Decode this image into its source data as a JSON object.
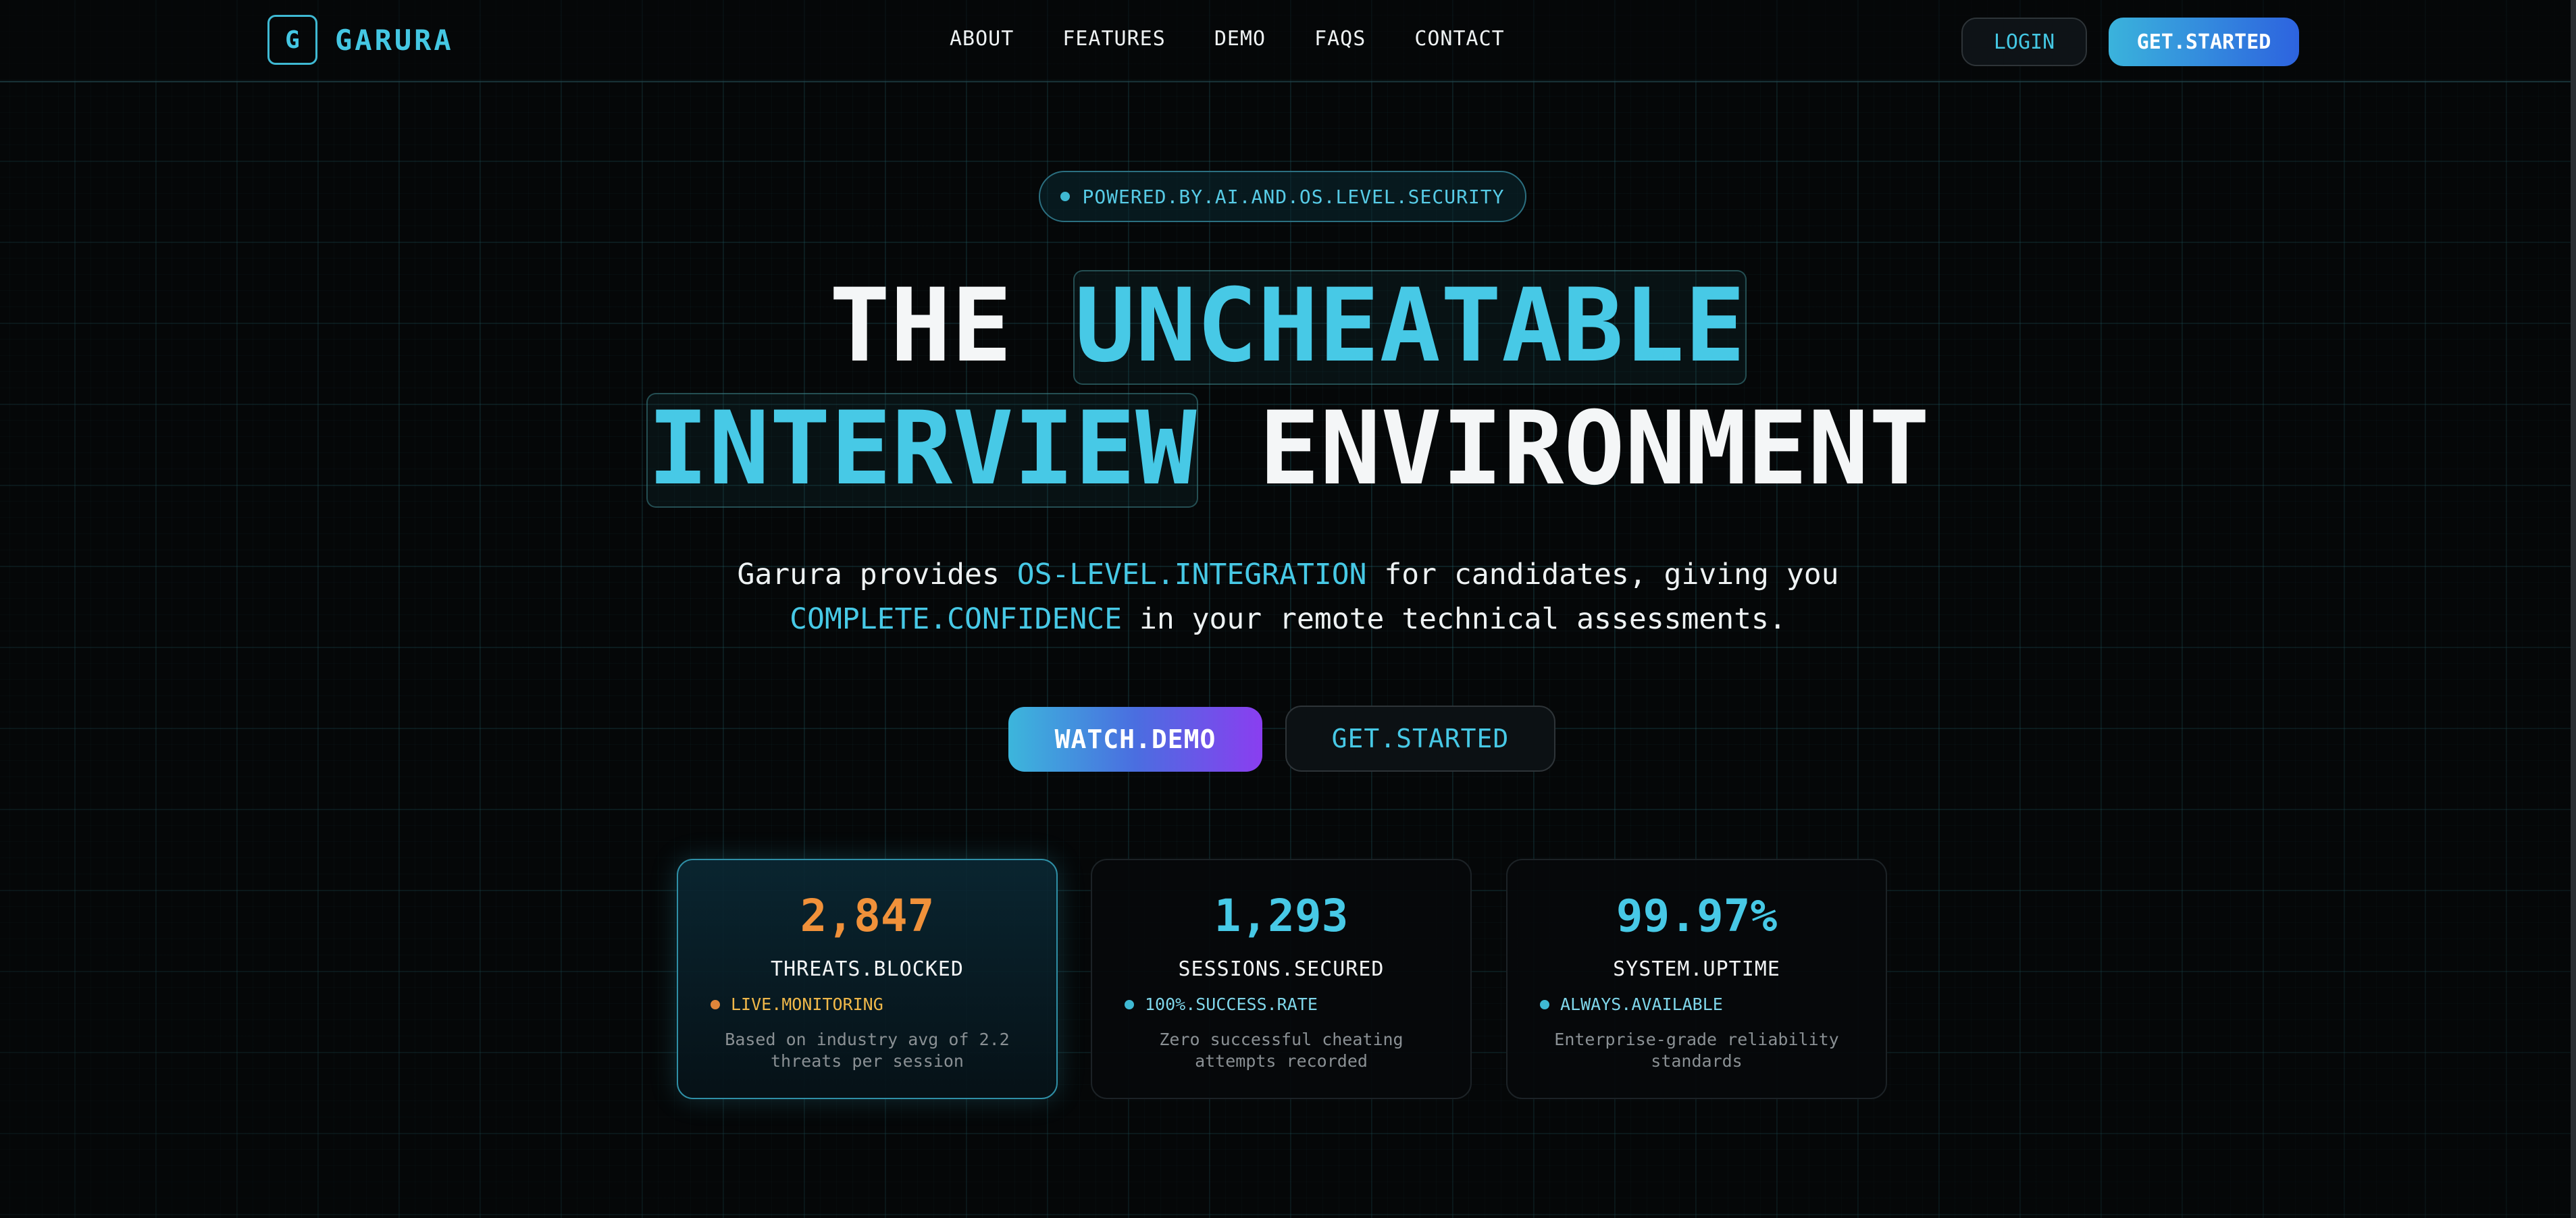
{
  "colors": {
    "accent_cyan": "#47c9e6",
    "accent_orange": "#f0913a",
    "gradient_purple": "#8a3ef0",
    "gradient_blue": "#2d63df",
    "background": "#050708"
  },
  "nav": {
    "logo_letter": "G",
    "brand": "GARURA",
    "links": [
      "ABOUT",
      "FEATURES",
      "DEMO",
      "FAQS",
      "CONTACT"
    ],
    "login_label": "LOGIN",
    "get_started_label": "GET.STARTED"
  },
  "hero": {
    "badge": "POWERED.BY.AI.AND.OS.LEVEL.SECURITY",
    "headline": {
      "line1_plain": "THE",
      "line1_highlight": "UNCHEATABLE",
      "line2_highlight": "INTERVIEW",
      "line2_plain": "ENVIRONMENT"
    },
    "subtitle": {
      "part1": "Garura provides ",
      "accent1": "OS-LEVEL.INTEGRATION",
      "part2": " for candidates, giving you",
      "accent2": "COMPLETE.CONFIDENCE",
      "part3": " in your remote technical assessments."
    },
    "watch_demo_label": "WATCH.DEMO",
    "get_started_label": "GET.STARTED"
  },
  "stats": [
    {
      "value": "2,847",
      "label": "THREATS.BLOCKED",
      "status": "LIVE.MONITORING",
      "description": "Based on industry avg of 2.2 threats per session",
      "color": "#f0913a",
      "status_color": "#f0b84a",
      "dot_color": "#e0853a"
    },
    {
      "value": "1,293",
      "label": "SESSIONS.SECURED",
      "status": "100%.SUCCESS.RATE",
      "description": "Zero successful cheating attempts recorded",
      "color": "#47c9e6",
      "status_color": "#7fd6ea",
      "dot_color": "#3fb9d3"
    },
    {
      "value": "99.97%",
      "label": "SYSTEM.UPTIME",
      "status": "ALWAYS.AVAILABLE",
      "description": "Enterprise-grade reliability standards",
      "color": "#47c9e6",
      "status_color": "#7fd6ea",
      "dot_color": "#3fb9d3"
    }
  ]
}
